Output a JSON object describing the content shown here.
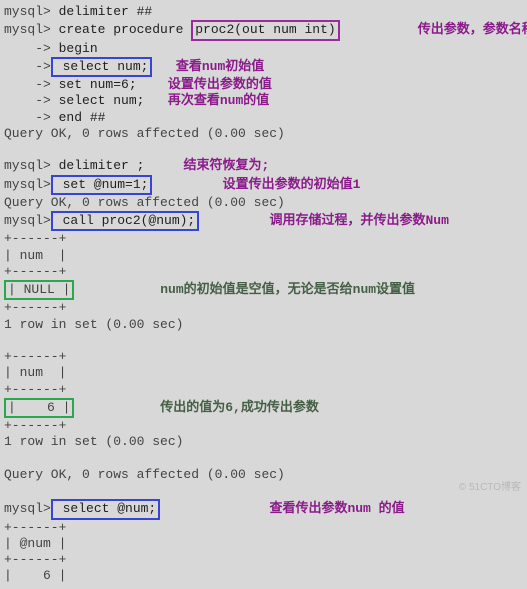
{
  "l1": {
    "prompt": "mysql>",
    "cmd": " delimiter ##"
  },
  "l2": {
    "prompt": "mysql>",
    "pre": " create procedure ",
    "box": "proc2(out num int)",
    "note_space": "          ",
    "note": "传出参数，参数名称为num"
  },
  "l3": {
    "arrow": "    ->",
    "cmd": " begin"
  },
  "l4": {
    "arrow": "    ->",
    "box": " select num;",
    "sp": "   ",
    "note": "查看num初始值"
  },
  "l5": {
    "arrow": "    ->",
    "cmd": " set num=6;",
    "sp": "    ",
    "note": "设置传出参数的值"
  },
  "l6": {
    "arrow": "    ->",
    "cmd": " select num;",
    "sp": "   ",
    "note": "再次查看num的值"
  },
  "l7": {
    "arrow": "    ->",
    "cmd": " end ##"
  },
  "l8": "Query OK, 0 rows affected (0.00 sec)",
  "blank": " ",
  "l9": {
    "prompt": "mysql>",
    "cmd": " delimiter ;",
    "sp": "     ",
    "note": "结束符恢复为;"
  },
  "l10": {
    "prompt": "mysql>",
    "box": " set @num=1;",
    "sp": "         ",
    "note": "设置传出参数的初始值1"
  },
  "l11": "Query OK, 0 rows affected (0.00 sec)",
  "l12": {
    "prompt": "mysql>",
    "box": " call proc2(@num);",
    "sp": "         ",
    "note": "调用存储过程，并传出参数Num"
  },
  "t1border": "+------+",
  "t1head": "| num  |",
  "t1val": "| NULL |",
  "t1note_sp": "           ",
  "t1note": "num的初始值是空值，无论是否给num设置值",
  "t1rs": "1 row in set (0.00 sec)",
  "t2border": "+------+",
  "t2head": "| num  |",
  "t2val": "|    6 |",
  "t2note_sp": "           ",
  "t2note": "传出的值为6,成功传出参数",
  "t2rs": "1 row in set (0.00 sec)",
  "qok2": "Query OK, 0 rows affected (0.00 sec)",
  "l13": {
    "prompt": "mysql>",
    "box": " select @num;",
    "sp": "              ",
    "note": "查看传出参数num 的值"
  },
  "t3border": "+------+",
  "t3head": "| @num |",
  "t3val": "|    6 |",
  "watermark": "© 51CTO博客"
}
